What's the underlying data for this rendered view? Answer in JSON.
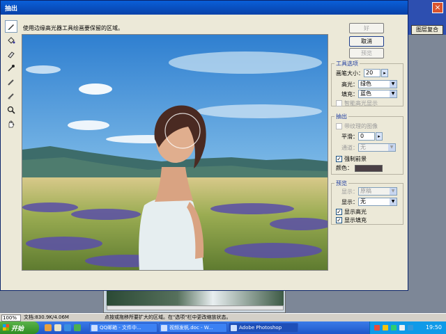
{
  "dialog": {
    "title": "抽出",
    "instruction": "使用边缘高光器工具绘画要保留的区域。"
  },
  "buttons": {
    "ok": "好",
    "cancel": "取消",
    "preview": "预览"
  },
  "tool_options": {
    "title": "工具选项",
    "brush_size_label": "画笔大小：",
    "brush_size_value": "20",
    "highlight_label": "高光：",
    "highlight_value": "绿色",
    "fill_label": "填充：",
    "fill_value": "蓝色",
    "smart_highlight_label": "智能高光显示"
  },
  "extraction": {
    "title": "抽出",
    "textured_label": "带纹理的图像",
    "smooth_label": "平滑：",
    "smooth_value": "0",
    "channel_label": "通道：",
    "channel_value": "无",
    "force_fg_label": "强制前景",
    "color_label": "颜色：",
    "fg_color": "#4a4045"
  },
  "preview_group": {
    "title": "预览",
    "show_label": "显示：",
    "show_value": "原稿",
    "display_label": "显示：",
    "display_value": "无",
    "show_highlight_label": "显示高光",
    "show_fill_label": "显示填充"
  },
  "status_bar": {
    "zoom": "100%",
    "doc_info": "文档:830.9K/4.06M",
    "tip": "点按或拖移所要扩大的区域。在\"选项\"栏中更改缩放状态。"
  },
  "right_window": {
    "button_label": "图层复合"
  },
  "taskbar": {
    "start_label": "开始",
    "tasks": [
      "QQ邮箱 - 文件中...",
      "视频发帆.doc - W...",
      "Adobe Photoshop"
    ],
    "clock": "19:50"
  },
  "tools": [
    "edge-highlighter-icon",
    "fill-icon",
    "eraser-icon",
    "eyedropper-icon",
    "cleanup-icon",
    "edge-touchup-icon",
    "zoom-icon",
    "hand-icon"
  ],
  "colors": {
    "title_bar": "#0a5fd8",
    "group_title": "#1f3da0",
    "taskbar": "#1f56c9"
  }
}
